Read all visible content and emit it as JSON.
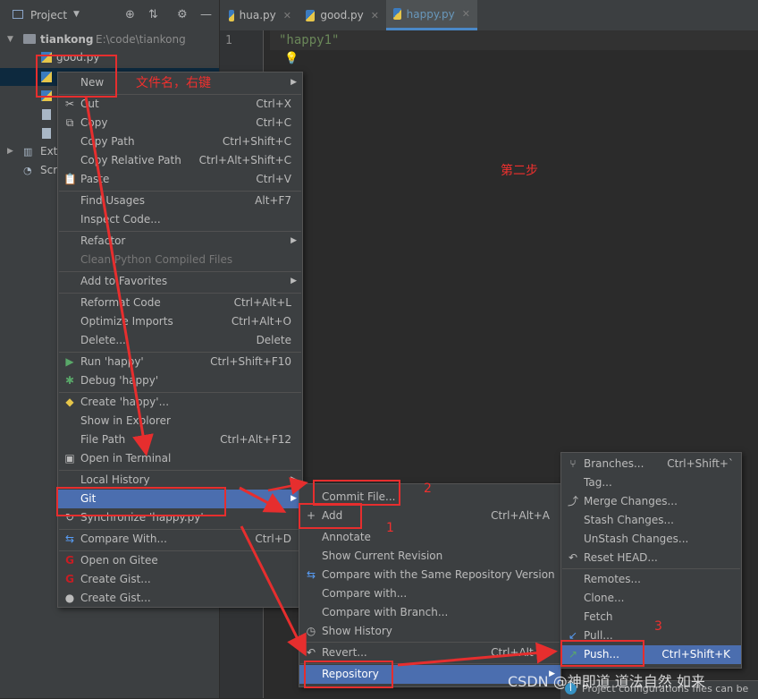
{
  "project_panel": {
    "title": "Project",
    "root_name": "tiankong",
    "root_path": "E:\\code\\tiankong",
    "file_good": "good.py",
    "ext_item": "Exte",
    "scr_item": "Scr"
  },
  "editor": {
    "tabs": [
      {
        "label": "hua.py"
      },
      {
        "label": "good.py"
      },
      {
        "label": "happy.py"
      }
    ],
    "line_number": "1",
    "code": "\"happy1\""
  },
  "context_menu": {
    "items": [
      {
        "label": "New",
        "shortcut": "",
        "submenu": true
      },
      {
        "label": "Cut",
        "shortcut": "Ctrl+X"
      },
      {
        "label": "Copy",
        "shortcut": "Ctrl+C"
      },
      {
        "label": "Copy Path",
        "shortcut": "Ctrl+Shift+C"
      },
      {
        "label": "Copy Relative Path",
        "shortcut": "Ctrl+Alt+Shift+C"
      },
      {
        "label": "Paste",
        "shortcut": "Ctrl+V"
      },
      {
        "label": "Find Usages",
        "shortcut": "Alt+F7"
      },
      {
        "label": "Inspect Code...",
        "shortcut": ""
      },
      {
        "label": "Refactor",
        "shortcut": "",
        "submenu": true
      },
      {
        "label": "Clean Python Compiled Files",
        "shortcut": "",
        "disabled": true
      },
      {
        "label": "Add to Favorites",
        "shortcut": "",
        "submenu": true
      },
      {
        "label": "Reformat Code",
        "shortcut": "Ctrl+Alt+L"
      },
      {
        "label": "Optimize Imports",
        "shortcut": "Ctrl+Alt+O"
      },
      {
        "label": "Delete...",
        "shortcut": "Delete"
      },
      {
        "label": "Run 'happy'",
        "shortcut": "Ctrl+Shift+F10"
      },
      {
        "label": "Debug 'happy'",
        "shortcut": ""
      },
      {
        "label": "Create 'happy'...",
        "shortcut": ""
      },
      {
        "label": "Show in Explorer",
        "shortcut": ""
      },
      {
        "label": "File Path",
        "shortcut": "Ctrl+Alt+F12"
      },
      {
        "label": "Open in Terminal",
        "shortcut": ""
      },
      {
        "label": "Local History",
        "shortcut": "",
        "submenu": true
      },
      {
        "label": "Git",
        "shortcut": "",
        "submenu": true,
        "selected": true
      },
      {
        "label": "Synchronize 'happy.py'",
        "shortcut": ""
      },
      {
        "label": "Compare With...",
        "shortcut": "Ctrl+D"
      },
      {
        "label": "Open on Gitee",
        "shortcut": ""
      },
      {
        "label": "Create Gist...",
        "shortcut": ""
      },
      {
        "label": "Create Gist...",
        "shortcut": ""
      }
    ]
  },
  "git_menu": {
    "items": [
      {
        "label": "Commit File...",
        "shortcut": ""
      },
      {
        "label": "Add",
        "shortcut": "Ctrl+Alt+A"
      },
      {
        "label": "Annotate",
        "shortcut": ""
      },
      {
        "label": "Show Current Revision",
        "shortcut": ""
      },
      {
        "label": "Compare with the Same Repository Version",
        "shortcut": ""
      },
      {
        "label": "Compare with...",
        "shortcut": ""
      },
      {
        "label": "Compare with Branch...",
        "shortcut": ""
      },
      {
        "label": "Show History",
        "shortcut": ""
      },
      {
        "label": "Revert...",
        "shortcut": "Ctrl+Alt+Z"
      },
      {
        "label": "Repository",
        "shortcut": "",
        "submenu": true,
        "selected": true
      }
    ]
  },
  "repo_menu": {
    "items": [
      {
        "label": "Branches...",
        "shortcut": "Ctrl+Shift+`"
      },
      {
        "label": "Tag...",
        "shortcut": ""
      },
      {
        "label": "Merge Changes...",
        "shortcut": ""
      },
      {
        "label": "Stash Changes...",
        "shortcut": ""
      },
      {
        "label": "UnStash Changes...",
        "shortcut": ""
      },
      {
        "label": "Reset HEAD...",
        "shortcut": ""
      },
      {
        "label": "Remotes...",
        "shortcut": ""
      },
      {
        "label": "Clone...",
        "shortcut": ""
      },
      {
        "label": "Fetch",
        "shortcut": ""
      },
      {
        "label": "Pull...",
        "shortcut": ""
      },
      {
        "label": "Push...",
        "shortcut": "Ctrl+Shift+K",
        "selected": true
      }
    ]
  },
  "annotations": {
    "filename_note": "文件名，右键",
    "step_two": "第二步",
    "num1": "1",
    "num2": "2",
    "num3": "3"
  },
  "status": {
    "notice": "Project configurations files can be",
    "watermark": "CSDN @神即道 道法自然 如来"
  },
  "colors": {
    "accent": "#4b6eaf",
    "annotation_red": "#e62e2e"
  }
}
